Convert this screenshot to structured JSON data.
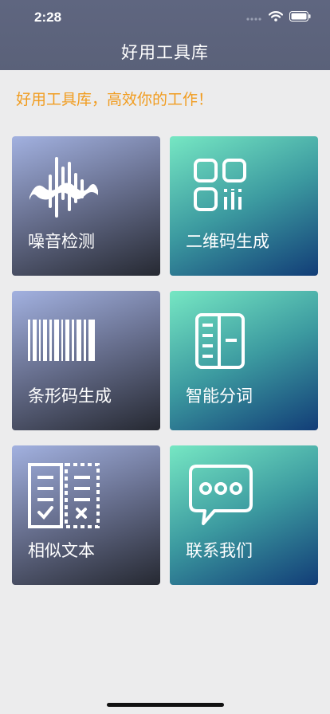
{
  "status_bar": {
    "time": "2:28"
  },
  "header": {
    "title": "好用工具库"
  },
  "tagline": "好用工具库，高效你的工作！",
  "cards": [
    {
      "label": "噪音检测",
      "icon": "sound-wave-icon"
    },
    {
      "label": "二维码生成",
      "icon": "qr-code-icon"
    },
    {
      "label": "条形码生成",
      "icon": "barcode-icon"
    },
    {
      "label": "智能分词",
      "icon": "word-segment-icon"
    },
    {
      "label": "相似文本",
      "icon": "text-compare-icon"
    },
    {
      "label": "联系我们",
      "icon": "chat-bubble-icon"
    }
  ],
  "colors": {
    "accent": "#f19c1f",
    "header": "#5f6680"
  }
}
